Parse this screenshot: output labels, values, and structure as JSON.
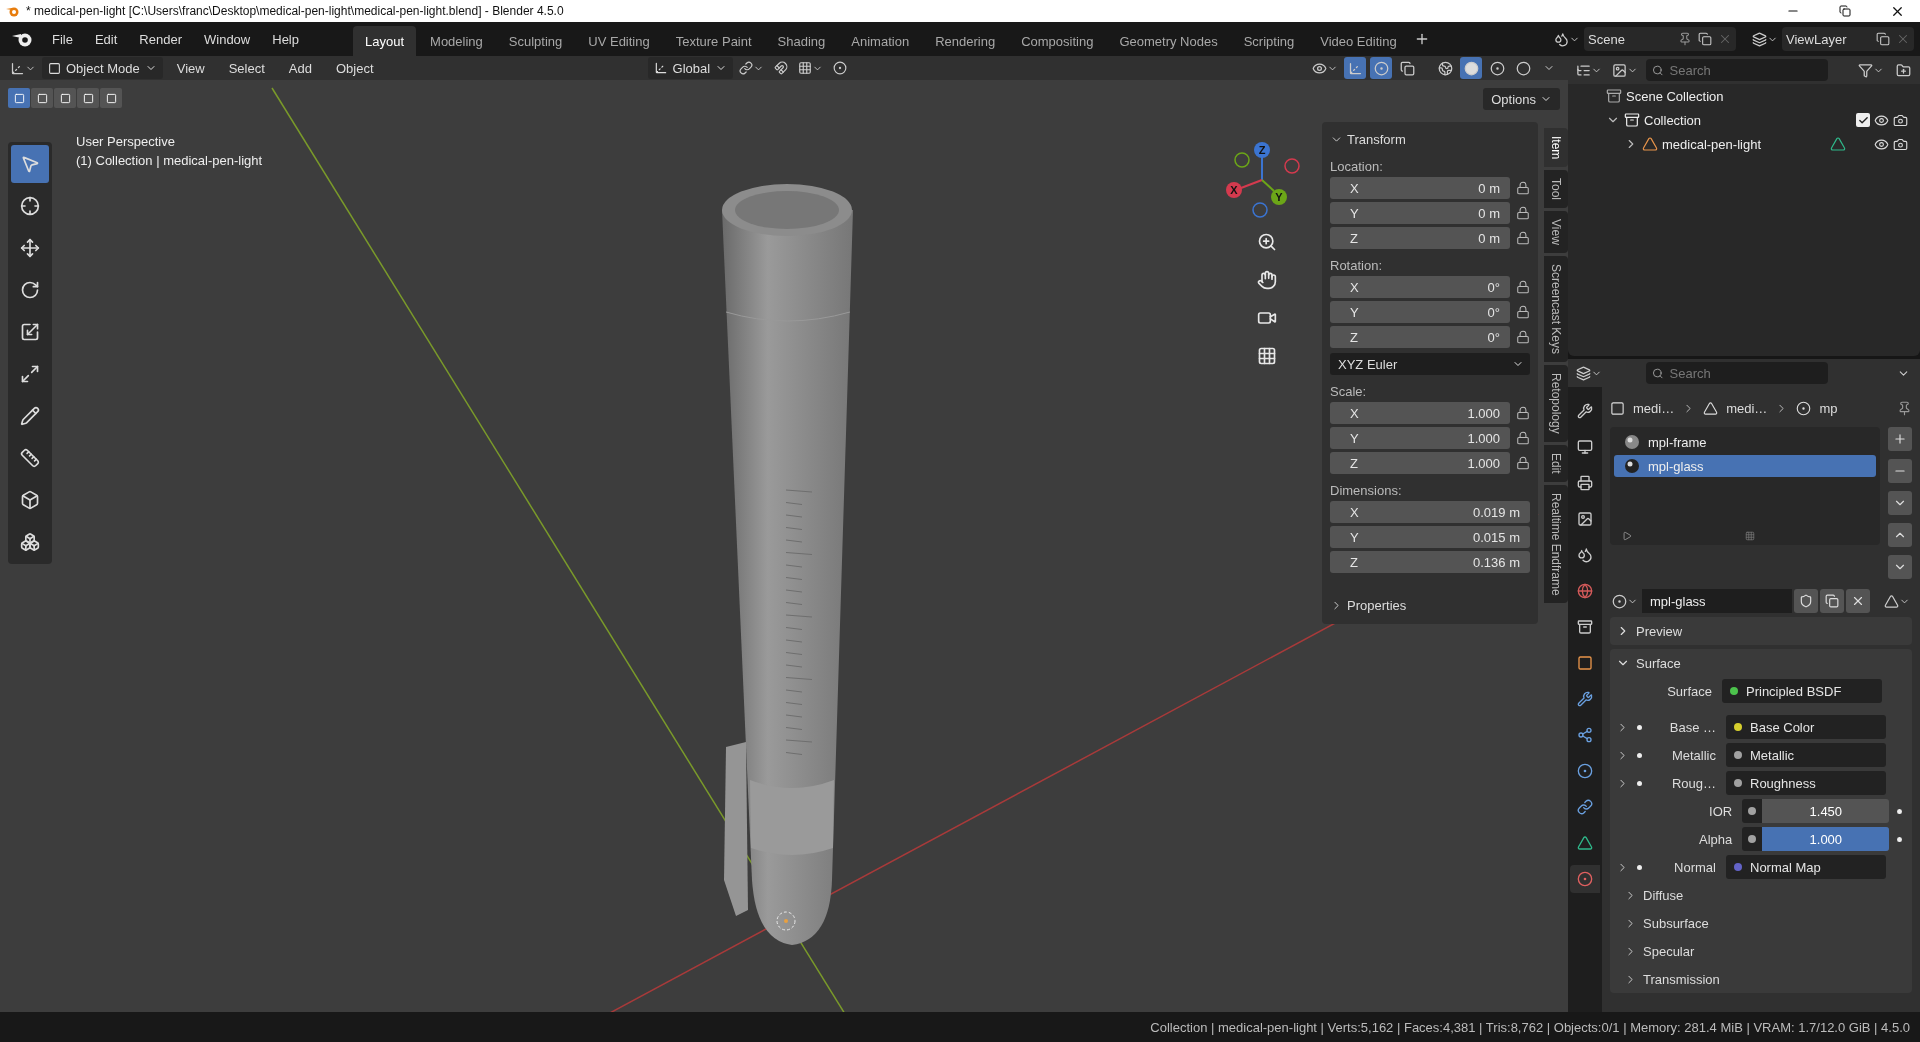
{
  "title_bar": {
    "title": "* medical-pen-light [C:\\Users\\franc\\Desktop\\medical-pen-light\\medical-pen-light.blend] - Blender 4.5.0"
  },
  "menu": [
    "File",
    "Edit",
    "Render",
    "Window",
    "Help"
  ],
  "workspaces": [
    {
      "label": "Layout",
      "selected": true
    },
    {
      "label": "Modeling",
      "selected": false
    },
    {
      "label": "Sculpting",
      "selected": false
    },
    {
      "label": "UV Editing",
      "selected": false
    },
    {
      "label": "Texture Paint",
      "selected": false
    },
    {
      "label": "Shading",
      "selected": false
    },
    {
      "label": "Animation",
      "selected": false
    },
    {
      "label": "Rendering",
      "selected": false
    },
    {
      "label": "Compositing",
      "selected": false
    },
    {
      "label": "Geometry Nodes",
      "selected": false
    },
    {
      "label": "Scripting",
      "selected": false
    },
    {
      "label": "Video Editing",
      "selected": false
    }
  ],
  "scene": "Scene",
  "view_layer": "ViewLayer",
  "viewport_header": {
    "mode": "Object Mode",
    "menus": [
      "View",
      "Select",
      "Add",
      "Object"
    ],
    "orientation": "Global",
    "toggles": [
      {
        "kind": "gizmos",
        "on": true
      },
      {
        "kind": "overlays",
        "on": true
      },
      {
        "kind": "xray",
        "on": false
      }
    ],
    "shading": [
      {
        "kind": "wireframe",
        "selected": false
      },
      {
        "kind": "solid",
        "selected": true
      },
      {
        "kind": "material",
        "selected": false
      },
      {
        "kind": "rendered",
        "selected": false
      }
    ]
  },
  "select_modes": [
    {
      "selected": true
    },
    {
      "selected": false
    },
    {
      "selected": false
    },
    {
      "selected": false
    },
    {
      "selected": false
    }
  ],
  "tools": [
    {
      "kind": "select",
      "selected": true
    },
    {
      "kind": "cursor",
      "selected": false
    },
    {
      "kind": "move",
      "selected": false
    },
    {
      "kind": "rotate",
      "selected": false
    },
    {
      "kind": "scale",
      "selected": false
    },
    {
      "kind": "transform",
      "selected": false
    },
    {
      "kind": "annotate",
      "selected": false
    },
    {
      "kind": "measure",
      "selected": false
    },
    {
      "kind": "add_cube",
      "selected": false
    },
    {
      "kind": "extrude",
      "selected": false
    }
  ],
  "viewport": {
    "perspective": "User Perspective",
    "info": "(1) Collection | medical-pen-light",
    "options": "Options",
    "gizmo_axes": [
      "X",
      "Y",
      "Z"
    ]
  },
  "n_panel": {
    "title": "Transform",
    "groups": [
      {
        "label": "Location:",
        "lockable": true,
        "rows": [
          {
            "axis": "X",
            "value": "0 m"
          },
          {
            "axis": "Y",
            "value": "0 m"
          },
          {
            "axis": "Z",
            "value": "0 m"
          }
        ]
      },
      {
        "label": "Rotation:",
        "lockable": true,
        "rows": [
          {
            "axis": "X",
            "value": "0°"
          },
          {
            "axis": "Y",
            "value": "0°"
          },
          {
            "axis": "Z",
            "value": "0°"
          }
        ],
        "mode": "XYZ Euler"
      },
      {
        "label": "Scale:",
        "lockable": true,
        "rows": [
          {
            "axis": "X",
            "value": "1.000"
          },
          {
            "axis": "Y",
            "value": "1.000"
          },
          {
            "axis": "Z",
            "value": "1.000"
          }
        ]
      },
      {
        "label": "Dimensions:",
        "lockable": false,
        "rows": [
          {
            "axis": "X",
            "value": "0.019 m"
          },
          {
            "axis": "Y",
            "value": "0.015 m"
          },
          {
            "axis": "Z",
            "value": "0.136 m"
          }
        ]
      }
    ],
    "properties": "Properties",
    "tabs": [
      {
        "label": "Item",
        "selected": true
      },
      {
        "label": "Tool",
        "selected": false
      },
      {
        "label": "View",
        "selected": false
      },
      {
        "label": "Screencast Keys",
        "selected": false
      },
      {
        "label": "Retopology",
        "selected": false
      },
      {
        "label": "Edit",
        "selected": false
      },
      {
        "label": "Realtime Endframe",
        "selected": false
      }
    ]
  },
  "outliner": {
    "search_placeholder": "Search",
    "items": [
      {
        "label": "Scene Collection",
        "kind": "scene",
        "children": [
          {
            "label": "Collection",
            "kind": "collection",
            "expanded": true,
            "checked": true,
            "children": [
              {
                "label": "medical-pen-light",
                "kind": "object",
                "expanded": false
              }
            ]
          }
        ]
      }
    ]
  },
  "properties": {
    "search_placeholder": "Search",
    "tabs": [
      {
        "kind": "tool",
        "selected": false
      },
      {
        "kind": "render",
        "selected": false
      },
      {
        "kind": "output",
        "selected": false
      },
      {
        "kind": "view_layer",
        "selected": false
      },
      {
        "kind": "scene",
        "selected": false
      },
      {
        "kind": "world",
        "selected": false
      },
      {
        "kind": "collection",
        "selected": false
      },
      {
        "kind": "object",
        "selected": false
      },
      {
        "kind": "modifiers",
        "selected": false
      },
      {
        "kind": "particles",
        "selected": false
      },
      {
        "kind": "physics",
        "selected": false
      },
      {
        "kind": "constraints",
        "selected": false
      },
      {
        "kind": "data",
        "selected": false
      },
      {
        "kind": "material",
        "selected": true
      }
    ],
    "breadcrumb": [
      {
        "kind": "object",
        "label": "medi…"
      },
      {
        "kind": "mesh",
        "label": "medi…"
      },
      {
        "kind": "material",
        "label": "mp"
      }
    ],
    "materials": [
      {
        "name": "mpl-frame",
        "selected": false
      },
      {
        "name": "mpl-glass",
        "selected": true
      }
    ],
    "material_name": "mpl-glass",
    "panels": [
      {
        "title": "Preview",
        "expanded": false
      },
      {
        "title": "Surface",
        "expanded": true
      }
    ],
    "surface": {
      "label": "Surface",
      "shader": "Principled BSDF",
      "color": "#4cc34c"
    },
    "inputs": [
      {
        "label": "Base …",
        "kind": "link",
        "value": "Base Color",
        "color": "#d6cf2e"
      },
      {
        "label": "Metallic",
        "kind": "link",
        "value": "Metallic",
        "color": "#a1a1a1"
      },
      {
        "label": "Roug…",
        "kind": "link",
        "value": "Roughness",
        "color": "#a1a1a1"
      },
      {
        "label": "IOR",
        "kind": "number",
        "value": "1.450",
        "color": "#a1a1a1"
      },
      {
        "label": "Alpha",
        "kind": "slider",
        "value": "1.000",
        "color": "#a1a1a1",
        "level": 1
      },
      {
        "label": "Normal",
        "kind": "link",
        "value": "Normal Map",
        "color": "#6363c7"
      }
    ],
    "subpanels": [
      "Diffuse",
      "Subsurface",
      "Specular",
      "Transmission"
    ]
  },
  "status_bar": "Collection | medical-pen-light | Verts:5,162 | Faces:4,381 | Tris:8,762 | Objects:0/1 | Memory: 281.4 MiB | VRAM: 1.7/12.0 GiB | 4.5.0"
}
